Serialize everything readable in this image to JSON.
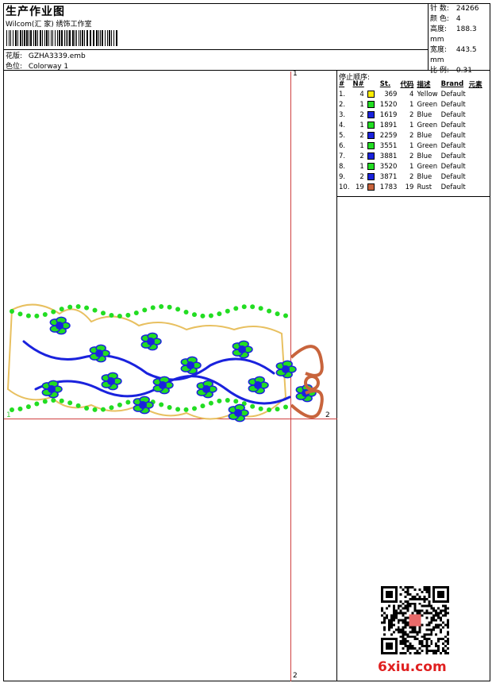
{
  "header": {
    "title": "生产作业图",
    "company": "Wilcom(汇 家) 绣饰工作室",
    "design_label": "花版:",
    "design_value": "GZHA3339.emb",
    "colorway_label": "色位:",
    "colorway_value": "Colorway 1"
  },
  "stats": {
    "stitches_label": "针 数:",
    "stitches_value": "24266",
    "colors_label": "颜 色:",
    "colors_value": "4",
    "height_label": "高度:",
    "height_value": "188.3 mm",
    "width_label": "宽度:",
    "width_value": "443.5 mm",
    "scale_label": "比 例:",
    "scale_value": "0.31"
  },
  "stop_sequence": {
    "heading": "停止顺序:",
    "columns": [
      "#",
      "N#",
      "St.",
      "代码",
      "描述",
      "Brand",
      "元素"
    ],
    "rows": [
      {
        "idx": "1.",
        "n": "4",
        "color": "#ffee00",
        "st": "369",
        "code": "4",
        "desc": "Yellow",
        "brand": "Default"
      },
      {
        "idx": "2.",
        "n": "1",
        "color": "#22dd22",
        "st": "1520",
        "code": "1",
        "desc": "Green",
        "brand": "Default"
      },
      {
        "idx": "3.",
        "n": "2",
        "color": "#1a22dd",
        "st": "1619",
        "code": "2",
        "desc": "Blue",
        "brand": "Default"
      },
      {
        "idx": "4.",
        "n": "1",
        "color": "#22dd22",
        "st": "1891",
        "code": "1",
        "desc": "Green",
        "brand": "Default"
      },
      {
        "idx": "5.",
        "n": "2",
        "color": "#1a22dd",
        "st": "2259",
        "code": "2",
        "desc": "Blue",
        "brand": "Default"
      },
      {
        "idx": "6.",
        "n": "1",
        "color": "#22dd22",
        "st": "3551",
        "code": "1",
        "desc": "Green",
        "brand": "Default"
      },
      {
        "idx": "7.",
        "n": "2",
        "color": "#1a22dd",
        "st": "3881",
        "code": "2",
        "desc": "Blue",
        "brand": "Default"
      },
      {
        "idx": "8.",
        "n": "1",
        "color": "#22dd22",
        "st": "3520",
        "code": "1",
        "desc": "Green",
        "brand": "Default"
      },
      {
        "idx": "9.",
        "n": "2",
        "color": "#1a22dd",
        "st": "3871",
        "code": "2",
        "desc": "Blue",
        "brand": "Default"
      },
      {
        "idx": "10.",
        "n": "19",
        "color": "#c8643c",
        "st": "1783",
        "code": "19",
        "desc": "Rust",
        "brand": "Default"
      }
    ]
  },
  "markers": {
    "one_top": "1",
    "one_left": "1",
    "two_right": "2",
    "two_bottom": "2"
  },
  "watermark": "6xiu.com",
  "colors": {
    "guide": "#d04040",
    "green": "#22dd22",
    "blue": "#1a22dd",
    "yellow": "#ffee00",
    "rust": "#c8643c"
  }
}
